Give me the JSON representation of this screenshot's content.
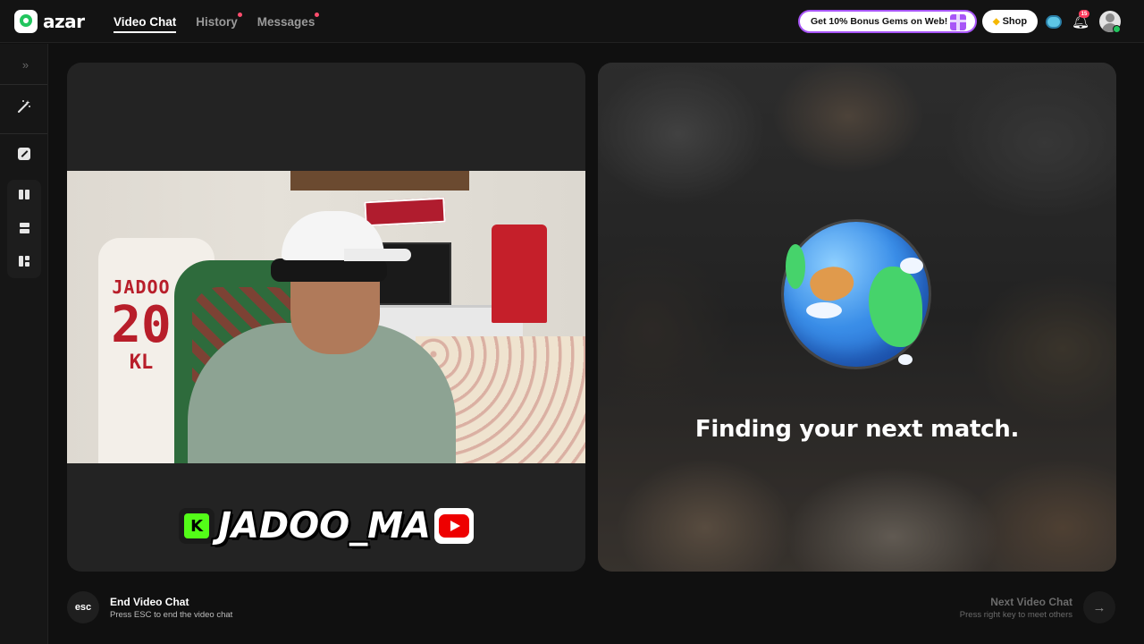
{
  "app": {
    "logo_text": "azar"
  },
  "nav": {
    "items": [
      {
        "label": "Video Chat",
        "active": true,
        "dot": false
      },
      {
        "label": "History",
        "active": false,
        "dot": true
      },
      {
        "label": "Messages",
        "active": false,
        "dot": true
      }
    ]
  },
  "header": {
    "promo_label": "Get 10% Bonus Gems on Web!",
    "shop_label": "Shop",
    "notification_count": "15",
    "accent_color": "#a855f7"
  },
  "sidebar": {
    "icons": [
      "expand-icon",
      "magic-wand-icon",
      "filter-icon",
      "layout-side-by-side-icon",
      "layout-stacked-icon",
      "layout-grid-icon"
    ]
  },
  "local_video": {
    "username": "JADOO_MA",
    "kick_letter": "K",
    "jersey": {
      "name": "JADOO",
      "number": "20",
      "tag": "KL"
    }
  },
  "remote_video": {
    "status_text": "Finding your next match."
  },
  "footer": {
    "esc_label": "esc",
    "end_title": "End Video Chat",
    "end_sub": "Press ESC to end the video chat",
    "next_title": "Next Video Chat",
    "next_sub": "Press right key to meet others"
  }
}
